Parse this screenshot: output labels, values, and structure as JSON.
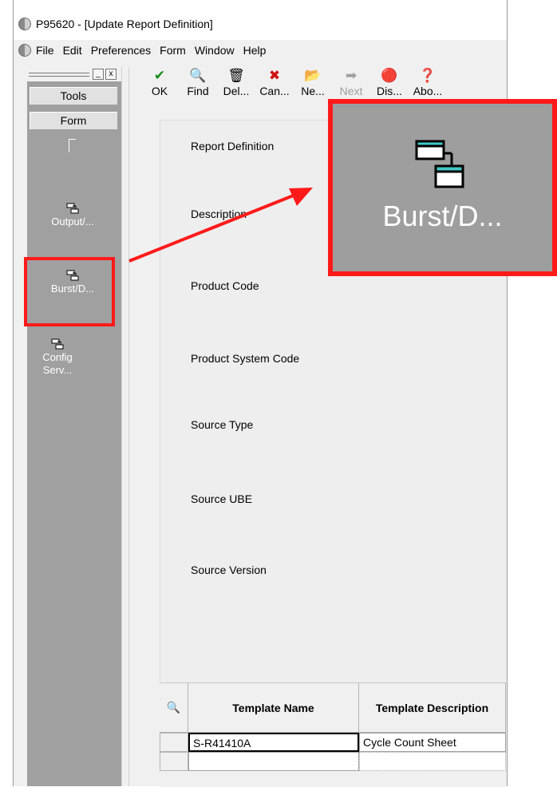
{
  "window": {
    "title": "P95620 - [Update Report Definition]"
  },
  "menu": [
    "File",
    "Edit",
    "Preferences",
    "Form",
    "Window",
    "Help"
  ],
  "left_pane": {
    "tools_label": "Tools",
    "form_label": "Form",
    "items": [
      "Output/...",
      "Burst/D...",
      "Config Serv..."
    ],
    "min_btn": "_",
    "close_btn": "x"
  },
  "toolbar": {
    "buttons": [
      {
        "label": "OK",
        "icon": "check-icon",
        "color": "#1a8a1a",
        "enabled": true
      },
      {
        "label": "Find",
        "icon": "find-icon",
        "enabled": true
      },
      {
        "label": "Del...",
        "icon": "trash-icon",
        "enabled": true
      },
      {
        "label": "Can...",
        "icon": "cancel-icon",
        "color": "#d01010",
        "enabled": true
      },
      {
        "label": "Ne...",
        "icon": "new-icon",
        "enabled": true
      },
      {
        "label": "Next",
        "icon": "next-icon",
        "enabled": false
      },
      {
        "label": "Dis...",
        "icon": "display-icon",
        "enabled": true
      },
      {
        "label": "Abo...",
        "icon": "about-icon",
        "enabled": true
      }
    ]
  },
  "form": {
    "fields": [
      "Report Definition",
      "Description",
      "Product Code",
      "Product System Code",
      "Source Type",
      "Source UBE",
      "Source Version"
    ]
  },
  "grid": {
    "columns": [
      "Template Name",
      "Template Description"
    ],
    "rows": [
      {
        "name": "S-R41410A",
        "description": "Cycle Count Sheet"
      },
      {
        "name": "",
        "description": ""
      }
    ]
  },
  "callout": {
    "label": "Burst/D..."
  },
  "colors": {
    "highlight": "#ff1a1a",
    "pane_bg": "#a0a0a0"
  }
}
